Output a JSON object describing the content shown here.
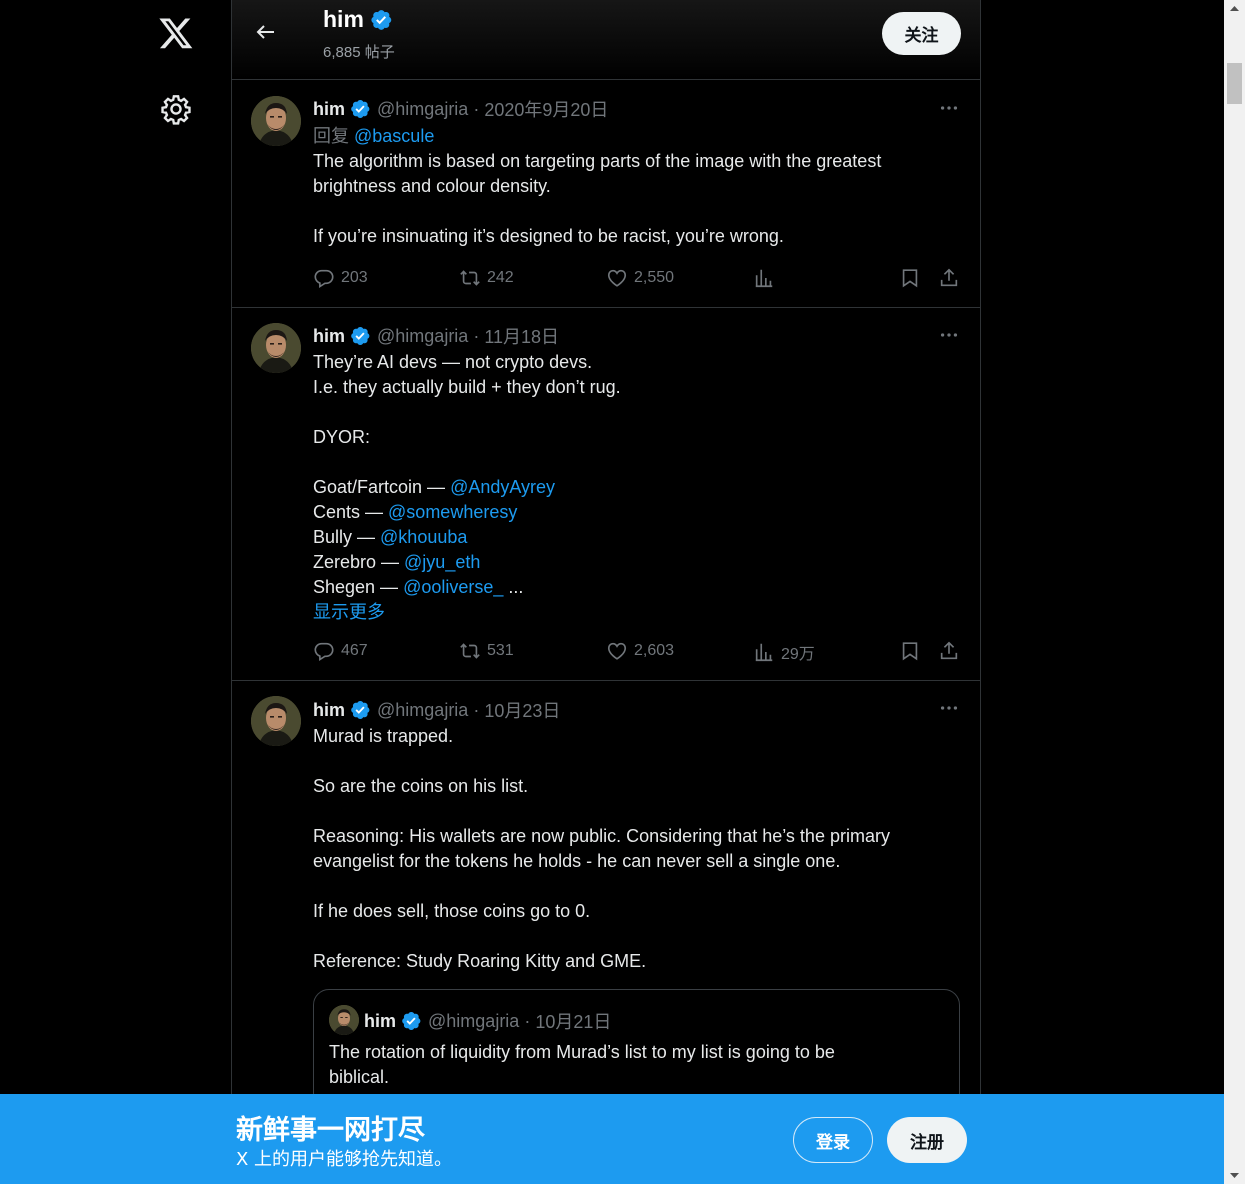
{
  "header": {
    "name": "him",
    "posts": "6,885 帖子",
    "follow_label": "关注"
  },
  "tweets": [
    {
      "name": "him",
      "handle": "@himgajria",
      "date": "2020年9月20日",
      "reply_prefix": "回复",
      "reply_to": "@bascule",
      "lines": [
        "The algorithm is based on targeting parts of the image with the greatest",
        "brightness and colour density.",
        "",
        "If you’re insinuating it’s designed to be racist, you’re wrong."
      ],
      "replies": "203",
      "retweets": "242",
      "likes": "2,550",
      "views": ""
    },
    {
      "name": "him",
      "handle": "@himgajria",
      "date": "11月18日",
      "intro": [
        "They’re AI devs — not crypto devs.",
        "I.e. they actually build + they don’t rug.",
        "",
        "DYOR:",
        ""
      ],
      "list": [
        {
          "label": "Goat/Fartcoin — ",
          "mention": "@AndyAyrey",
          "suffix": ""
        },
        {
          "label": "Cents — ",
          "mention": "@somewheresy",
          "suffix": ""
        },
        {
          "label": "Bully — ",
          "mention": "@khouuba",
          "suffix": ""
        },
        {
          "label": "Zerebro — ",
          "mention": "@jyu_eth",
          "suffix": ""
        },
        {
          "label": "Shegen — ",
          "mention": "@ooliverse_",
          "suffix": " ..."
        }
      ],
      "show_more": "显示更多",
      "replies": "467",
      "retweets": "531",
      "likes": "2,603",
      "views": "29万"
    },
    {
      "name": "him",
      "handle": "@himgajria",
      "date": "10月23日",
      "lines": [
        "Murad is trapped.",
        "",
        "So are the coins on his list.",
        "",
        "Reasoning: His wallets are now public. Considering that he’s the primary",
        "evangelist for the tokens he holds - he can never sell a single one.",
        "",
        "If he does sell, those coins go to 0.",
        "",
        "Reference: Study Roaring Kitty and GME."
      ],
      "quote": {
        "name": "him",
        "handle": "@himgajria",
        "date": "10月21日",
        "lines": [
          "The rotation of liquidity from Murad’s list to my list is going to be",
          "biblical."
        ]
      }
    }
  ],
  "banner": {
    "title": "新鲜事一网打尽",
    "subtitle": "X 上的用户能够抢先知道。",
    "login_label": "登录",
    "signup_label": "注册"
  },
  "colors": {
    "accent": "#1d9bf0",
    "background": "#000000",
    "text": "#e7e9ea",
    "muted": "#71767b",
    "border": "#2f3336"
  }
}
